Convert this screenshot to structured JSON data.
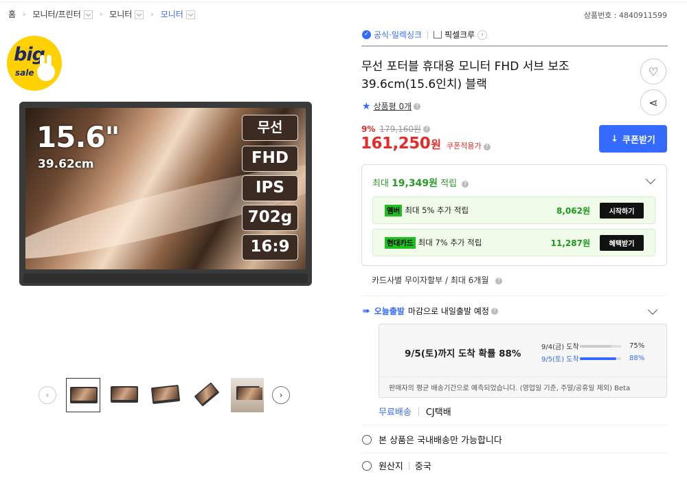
{
  "breadcrumb": {
    "items": [
      "홈",
      "모니터/프린터",
      "모니터",
      "모니터"
    ],
    "product_no": "상품번호 : 4840911599"
  },
  "badge": {
    "big": "big",
    "sale": "sale"
  },
  "image": {
    "size_big": "15.6\"",
    "size_cm": "39.62cm",
    "specs": [
      "무선",
      "FHD",
      "IPS",
      "702g",
      "16:9"
    ]
  },
  "seller": {
    "official": "공식·일렉싱크",
    "brand": "픽셀크루"
  },
  "product": {
    "title": "무선 포터블 휴대용 모니터 FHD 서브 보조 39.6cm(15.6인치) 블랙",
    "rating_label": "상품평 0개"
  },
  "price": {
    "discount": "9%",
    "original": "179,160원",
    "final": "161,250",
    "currency": "원",
    "coupon_label": "쿠폰적용가",
    "coupon_button": "쿠폰받기"
  },
  "reward": {
    "head_prefix": "최대",
    "head_amount": "19,349원",
    "head_suffix": "적립",
    "rows": [
      {
        "tag": "멤버",
        "text": "최대 5% 추가 적립",
        "amount": "8,062원",
        "button": "시작하기"
      },
      {
        "tag": "현대카드",
        "text": "최대 7% 추가 적립",
        "amount": "11,287원",
        "button": "혜택받기"
      }
    ]
  },
  "installment": "카드사별 무이자할부 / 최대 6개월",
  "shipping": {
    "today": "오늘출발",
    "today_desc": "마감으로 내일출발 예정",
    "headline": "9/5(토)까지 도착 확률 88%",
    "probs": [
      {
        "label": "9/4(금) 도착",
        "pct": "75%",
        "value": 75,
        "color": "#cccccc"
      },
      {
        "label": "9/5(토) 도착",
        "pct": "88%",
        "value": 88,
        "color": "#346aff"
      }
    ],
    "note": "판매자의 평균 배송기간으로 예측되었습니다. (영업일 기준, 주말/공휴일 제외) Beta",
    "free": "무료배송",
    "carrier": "CJ택배"
  },
  "domestic": "본 상품은 국내배송만 가능합니다",
  "origin": {
    "label": "원산지",
    "value": "중국"
  }
}
